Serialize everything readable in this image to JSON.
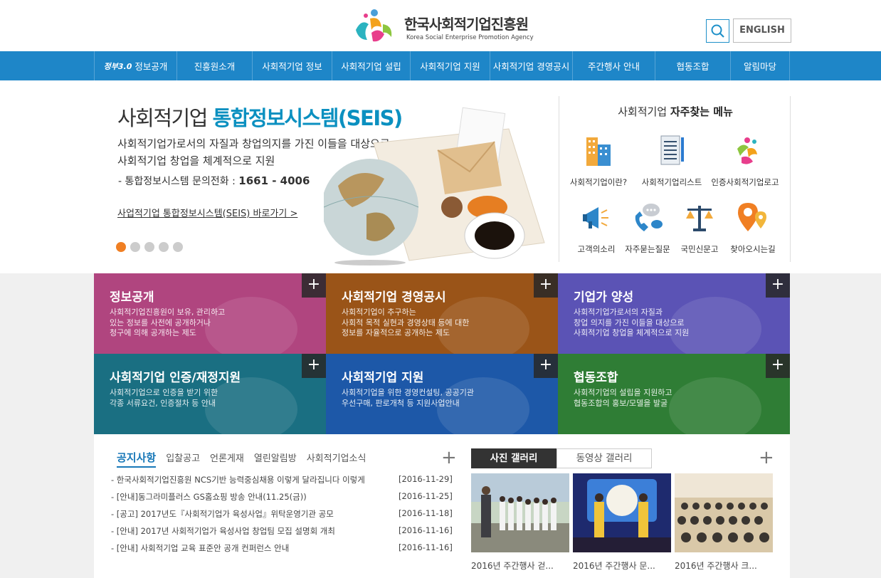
{
  "header": {
    "logo_korean": "한국사회적기업진흥원",
    "logo_english": "Korea Social Enterprise Promotion Agency",
    "english_button": "ENGLISH"
  },
  "nav": {
    "badge": "정부3.0",
    "items": [
      "정보공개",
      "진흥원소개",
      "사회적기업 정보",
      "사회적기업 설립",
      "사회적기업 지원",
      "사회적기업 경영공시",
      "주간행사 안내",
      "협동조합",
      "알림마당"
    ]
  },
  "hero": {
    "title_plain": "사회적기업 ",
    "title_accent": "통합정보시스템(SEIS)",
    "desc1": "사회적기업가로서의 자질과 창업의지를 가진 이들을 대상으로",
    "desc2": "사회적기업 창업을 체계적으로 지원",
    "phone_label": "- 통합정보시스템 문의전화 :",
    "phone_number": "1661 - 4006",
    "link": "사업적기업 통합정보시스템(SEIS) 바로가기 >",
    "slide_count": 5,
    "active_slide": 1
  },
  "quick_menu": {
    "title_plain": "사회적기업 ",
    "title_bold": "자주찾는 메뉴",
    "items": [
      {
        "label": "사회적기업이란?",
        "icon": "buildings-icon"
      },
      {
        "label": "사회적기업리스트",
        "icon": "document-list-icon"
      },
      {
        "label": "인증사회적기업로고",
        "icon": "se-logo-icon"
      },
      {
        "label": "고객의소리",
        "icon": "megaphone-icon"
      },
      {
        "label": "자주묻는질문",
        "icon": "phone-chat-icon"
      },
      {
        "label": "국민신문고",
        "icon": "scales-icon"
      },
      {
        "label": "찾아오시는길",
        "icon": "map-pin-icon"
      }
    ]
  },
  "tiles": [
    {
      "title": "정보공개",
      "lines": [
        "사회적기업진흥원이 보유, 관리하고",
        "있는 정보를 사전에 공개하거나",
        "청구에 의해 공개하는 제도"
      ],
      "color": "#b0457f",
      "plus": "+"
    },
    {
      "title": "사회적기업 경영공시",
      "lines": [
        "사회적기업이 추구하는",
        "사회적 목적 실현과 경영상태 등에 대한",
        "정보를 자율적으로 공개하는 제도"
      ],
      "color": "#9a5418",
      "plus": "+"
    },
    {
      "title": "기업가 양성",
      "lines": [
        "사회적기업가로서의 자질과",
        "창업 의지를 가진 이들을 대상으로",
        "사회적기업 창업을 체계적으로 지원"
      ],
      "color": "#5b53b5",
      "plus": "+"
    },
    {
      "title": "사회적기업 인증/재정지원",
      "lines": [
        "사회적기업으로 인증을 받기 위한",
        "각종 서류요건, 인증절차 등 안내"
      ],
      "color": "#1a6f82",
      "plus": "+"
    },
    {
      "title": "사회적기업 지원",
      "lines": [
        "사회적기업을 위한 경영컨설팅, 공공기관",
        "우선구매, 판로개척 등 지원사업안내"
      ],
      "color": "#1d58a8",
      "plus": "+"
    },
    {
      "title": "협동조합",
      "lines": [
        "사회적기업의 설립을 지원하고",
        "협동조합의 홍보/모델을 발굴"
      ],
      "color": "#2f7d35",
      "plus": "+"
    }
  ],
  "news": {
    "tabs": [
      "공지사항",
      "입찰공고",
      "언론게재",
      "열린알림방",
      "사회적기업소식"
    ],
    "plus": "+",
    "rows": [
      {
        "title": "- 한국사회적기업진흥원 NCS기반 능력중심채용 이렇게 달라집니다 이렇게",
        "date": "[2016-11-29]"
      },
      {
        "title": "- [안내]동그라미플러스 GS홈쇼핑 방송 안내(11.25(금))",
        "date": "[2016-11-25]"
      },
      {
        "title": "- [공고] 2017년도『사회적기업가 육성사업』위탁운영기관 공모",
        "date": "[2016-11-18]"
      },
      {
        "title": "- [안내] 2017년 사회적기업가 육성사업 창업팀 모집 설명회 개최",
        "date": "[2016-11-16]"
      },
      {
        "title": "- [안내] 사회적기업 교육 표준안 공개 컨퍼런스 안내",
        "date": "[2016-11-16]"
      }
    ]
  },
  "gallery": {
    "tabs": [
      "사진 갤러리",
      "동영상 갤러리"
    ],
    "plus": "+",
    "items": [
      {
        "caption": "2016년 주간행사 걷..."
      },
      {
        "caption": "2016년 주간행사 문..."
      },
      {
        "caption": "2016년 주간행사 크..."
      }
    ]
  }
}
